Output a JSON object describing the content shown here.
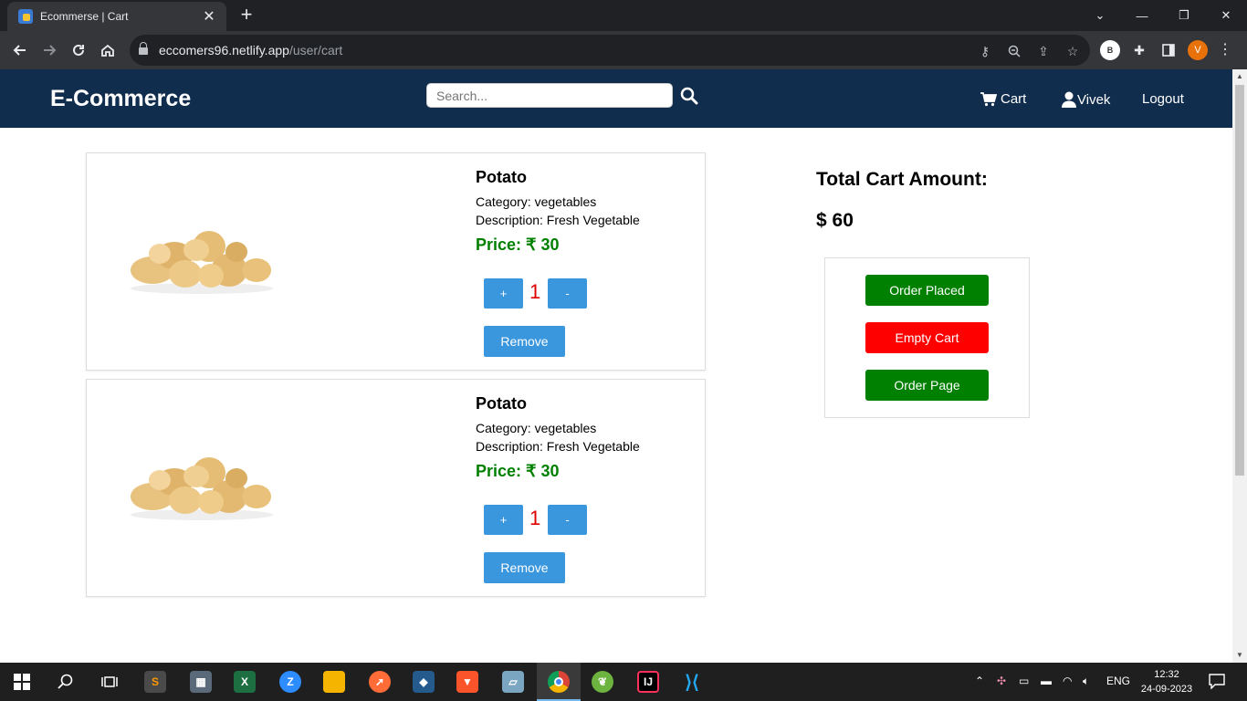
{
  "browser": {
    "tab_title": "Ecommerse | Cart",
    "url_host": "eccomers96.netlify.app",
    "url_path": "/user/cart",
    "profile_b": "B",
    "profile_v": "V"
  },
  "site": {
    "brand": "E-Commerce",
    "search_placeholder": "Search...",
    "nav": {
      "cart": "Cart",
      "user": "Vivek",
      "logout": "Logout"
    },
    "colors": {
      "navbar": "#112d4e",
      "price": "#008000",
      "qty": "#e00000",
      "primary_btn": "#3a96dd",
      "success": "#008000",
      "danger": "#ff0000"
    }
  },
  "cart": {
    "items": [
      {
        "name": "Potato",
        "category": "Category: vegetables",
        "description": "Description: Fresh Vegetable",
        "price": "Price: ₹ 30",
        "quantity": "1",
        "plus": "+",
        "minus": "-",
        "remove": "Remove"
      },
      {
        "name": "Potato",
        "category": "Category: vegetables",
        "description": "Description: Fresh Vegetable",
        "price": "Price: ₹ 30",
        "quantity": "1",
        "plus": "+",
        "minus": "-",
        "remove": "Remove"
      }
    ],
    "total_label": "Total Cart Amount:",
    "total_amount": "$ 60",
    "actions": {
      "order_placed": "Order Placed",
      "empty_cart": "Empty Cart",
      "order_page": "Order Page"
    }
  },
  "taskbar": {
    "language": "ENG",
    "time": "12:32",
    "date": "24-09-2023"
  }
}
